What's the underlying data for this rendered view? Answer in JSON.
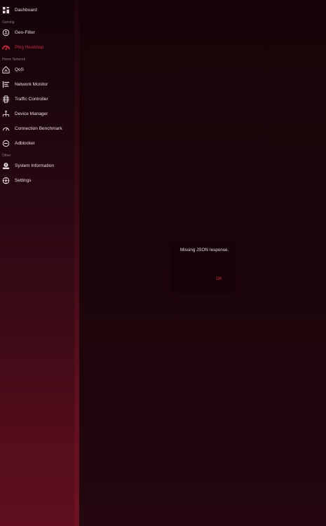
{
  "sidebar": {
    "items": [
      {
        "label": "Dashboard",
        "icon": "dashboard-icon"
      },
      {
        "label": "Geo-Filter",
        "icon": "geo-filter-icon"
      },
      {
        "label": "Ping Heatmap",
        "icon": "ping-heatmap-icon",
        "active": true
      },
      {
        "label": "QoS",
        "icon": "qos-icon"
      },
      {
        "label": "Network Monitor",
        "icon": "network-monitor-icon"
      },
      {
        "label": "Traffic Controller",
        "icon": "traffic-controller-icon"
      },
      {
        "label": "Device Manager",
        "icon": "device-manager-icon"
      },
      {
        "label": "Connection Benchmark",
        "icon": "connection-benchmark-icon"
      },
      {
        "label": "Adblocker",
        "icon": "adblocker-icon"
      },
      {
        "label": "System Information",
        "icon": "system-information-icon"
      },
      {
        "label": "Settings",
        "icon": "settings-icon"
      }
    ],
    "sections": {
      "gaming": "Gaming",
      "home_network": "Home Network",
      "other": "Other"
    }
  },
  "dialog": {
    "message": "Missing JSON response.",
    "ok_label": "OK"
  },
  "colors": {
    "accent": "#d4233a",
    "sidebar_bottom": "#5f0f1f",
    "background": "#1a050b"
  }
}
